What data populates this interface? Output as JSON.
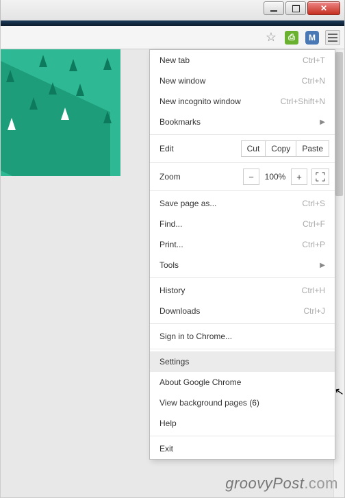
{
  "window": {
    "buttons": {
      "min": "minimize",
      "max": "maximize",
      "close": "close"
    }
  },
  "toolbar": {
    "star": "☆",
    "ext1_label": "⎙",
    "ext2_label": "M"
  },
  "menu": {
    "new_tab": {
      "label": "New tab",
      "shortcut": "Ctrl+T"
    },
    "new_window": {
      "label": "New window",
      "shortcut": "Ctrl+N"
    },
    "new_incognito": {
      "label": "New incognito window",
      "shortcut": "Ctrl+Shift+N"
    },
    "bookmarks": {
      "label": "Bookmarks"
    },
    "edit": {
      "label": "Edit",
      "cut": "Cut",
      "copy": "Copy",
      "paste": "Paste"
    },
    "zoom": {
      "label": "Zoom",
      "minus": "−",
      "value": "100%",
      "plus": "+"
    },
    "save_as": {
      "label": "Save page as...",
      "shortcut": "Ctrl+S"
    },
    "find": {
      "label": "Find...",
      "shortcut": "Ctrl+F"
    },
    "print": {
      "label": "Print...",
      "shortcut": "Ctrl+P"
    },
    "tools": {
      "label": "Tools"
    },
    "history": {
      "label": "History",
      "shortcut": "Ctrl+H"
    },
    "downloads": {
      "label": "Downloads",
      "shortcut": "Ctrl+J"
    },
    "signin": {
      "label": "Sign in to Chrome..."
    },
    "settings": {
      "label": "Settings"
    },
    "about": {
      "label": "About Google Chrome"
    },
    "bg_pages": {
      "label": "View background pages (6)"
    },
    "help": {
      "label": "Help"
    },
    "exit": {
      "label": "Exit"
    }
  },
  "watermark": "groovyPost",
  "watermark_suffix": ".com"
}
